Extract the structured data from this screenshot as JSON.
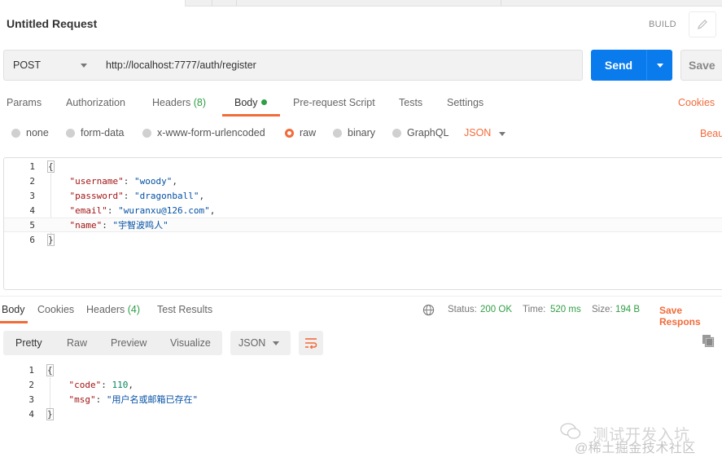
{
  "request": {
    "title": "Untitled Request",
    "build_label": "BUILD",
    "method": "POST",
    "url": "http://localhost:7777/auth/register",
    "send_label": "Send",
    "save_label": "Save"
  },
  "request_tabs": {
    "params": "Params",
    "authorization": "Authorization",
    "headers": "Headers",
    "headers_count": "(8)",
    "body": "Body",
    "pre_request": "Pre-request Script",
    "tests": "Tests",
    "settings": "Settings",
    "cookies": "Cookies"
  },
  "body_types": {
    "none": "none",
    "form_data": "form-data",
    "urlencoded": "x-www-form-urlencoded",
    "raw": "raw",
    "binary": "binary",
    "graphql": "GraphQL",
    "format": "JSON",
    "beautify": "Beau"
  },
  "request_body": {
    "line_numbers": [
      "1",
      "2",
      "3",
      "4",
      "5",
      "6"
    ],
    "open": "{",
    "close": "}",
    "fields": [
      {
        "key": "\"username\"",
        "value": "\"woody\"",
        "sep": ": ",
        "end": ","
      },
      {
        "key": "\"password\"",
        "value": "\"dragonball\"",
        "sep": ": ",
        "end": ","
      },
      {
        "key": "\"email\"",
        "value": "\"wuranxu@126.com\"",
        "sep": ": ",
        "end": ","
      },
      {
        "key": "\"name\"",
        "value": "\"宇智波鸣人\"",
        "sep": ": ",
        "end": ""
      }
    ]
  },
  "response_tabs": {
    "body": "Body",
    "cookies": "Cookies",
    "headers": "Headers",
    "headers_count": "(4)",
    "test_results": "Test Results"
  },
  "response_meta": {
    "status_label": "Status:",
    "status_value": "200 OK",
    "time_label": "Time:",
    "time_value": "520 ms",
    "size_label": "Size:",
    "size_value": "194 B",
    "save_response": "Save Respons"
  },
  "response_view": {
    "pretty": "Pretty",
    "raw": "Raw",
    "preview": "Preview",
    "visualize": "Visualize",
    "format": "JSON"
  },
  "response_body": {
    "line_numbers": [
      "1",
      "2",
      "3",
      "4"
    ],
    "open": "{",
    "close": "}",
    "fields": [
      {
        "key": "\"code\"",
        "value": "110",
        "sep": ": ",
        "end": ","
      },
      {
        "key": "\"msg\"",
        "value": "\"用户名或邮箱已存在\"",
        "sep": ": ",
        "end": ""
      }
    ]
  },
  "watermark": {
    "line1": "测试开发入坑",
    "line2": "@稀土掘金技术社区"
  },
  "colors": {
    "accent": "#f26b3a",
    "send_button": "#097bed",
    "status_ok": "#2f9e44",
    "json_key": "#a31515",
    "json_string": "#0451a5"
  }
}
